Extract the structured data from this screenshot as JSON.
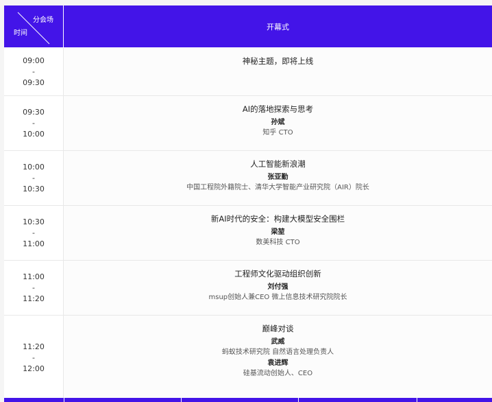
{
  "header": {
    "venue_label": "分会场",
    "time_label": "时间",
    "track_title": "开幕式"
  },
  "slots": [
    {
      "start": "09:00",
      "sep": "-",
      "end": "09:30",
      "title": "神秘主题，即将上线",
      "speakers": []
    },
    {
      "start": "09:30",
      "sep": "-",
      "end": "10:00",
      "title": "AI的落地探索与思考",
      "speakers": [
        {
          "name": "孙斌",
          "affiliation": "知乎 CTO"
        }
      ]
    },
    {
      "start": "10:00",
      "sep": "-",
      "end": "10:30",
      "title": "人工智能新浪潮",
      "speakers": [
        {
          "name": "张亚勤",
          "affiliation": "中国工程院外籍院士、清华大学智能产业研究院（AIR）院长"
        }
      ]
    },
    {
      "start": "10:30",
      "sep": "-",
      "end": "11:00",
      "title": "新AI时代的安全：构建大模型安全围栏",
      "speakers": [
        {
          "name": "梁堃",
          "affiliation": "数美科技 CTO"
        }
      ]
    },
    {
      "start": "11:00",
      "sep": "-",
      "end": "11:20",
      "title": "工程师文化驱动组织创新",
      "speakers": [
        {
          "name": "刘付强",
          "affiliation": "msup创始人兼CEO 微上信息技术研究院院长"
        }
      ]
    },
    {
      "start": "11:20",
      "sep": "-",
      "end": "12:00",
      "title": "巅峰对谈",
      "speakers": [
        {
          "name": "武威",
          "affiliation": "蚂蚁技术研究院 自然语言处理负责人"
        },
        {
          "name": "袁进辉",
          "affiliation": "硅基流动创始人、CEO"
        }
      ]
    }
  ]
}
